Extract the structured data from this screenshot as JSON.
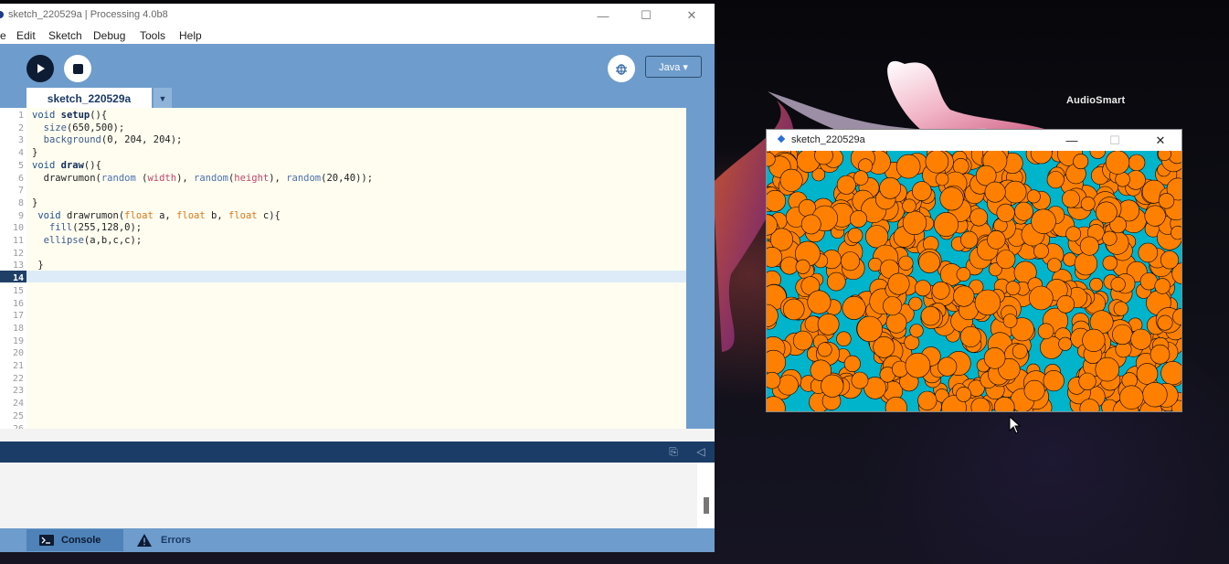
{
  "desktop": {
    "wallpaper_label": "AudioSmart"
  },
  "ide": {
    "title": "sketch_220529a | Processing 4.0b8",
    "window_controls": {
      "minimize": "—",
      "maximize": "☐",
      "close": "✕"
    },
    "menu": [
      "e",
      "Edit",
      "Sketch",
      "Debug",
      "Tools",
      "Help"
    ],
    "toolbar": {
      "run_icon": "play-icon",
      "stop_icon": "stop-icon",
      "debug_icon": "debugger-icon",
      "mode": "Java ▾"
    },
    "tabs": [
      {
        "label": "sketch_220529a",
        "menu_glyph": "▼"
      }
    ],
    "editor": {
      "current_line": 14,
      "line_numbers": [
        "1",
        "2",
        "3",
        "4",
        "5",
        "6",
        "7",
        "8",
        "9",
        "10",
        "11",
        "12",
        "13",
        "14",
        "15",
        "16",
        "17",
        "18",
        "19",
        "20",
        "21",
        "22",
        "23",
        "24",
        "25",
        "26"
      ],
      "code": [
        "void setup(){",
        "  size(650,500);",
        "  background(0, 204, 204);",
        "}",
        "void draw(){",
        "  drawrumon(random (width), random(height), random(20,40));",
        "",
        "}",
        " void drawrumon(float a, float b, float c){",
        "   fill(255,128,0);",
        "  ellipse(a,b,c,c);",
        "",
        " }",
        ""
      ]
    },
    "footer": {
      "console_label": "Console",
      "errors_label": "Errors"
    }
  },
  "sketch_window": {
    "title": "sketch_220529a",
    "window_controls": {
      "minimize": "—",
      "maximize": "☐",
      "close": "✕"
    },
    "canvas_background": "#00b4cc",
    "circle_fill": "#ff8000",
    "circle_stroke": "#000000"
  },
  "colors": {
    "toolbar_blue": "#6e9ccc",
    "status_navy": "#1b3c66",
    "editor_bg": "#fffdf0"
  }
}
